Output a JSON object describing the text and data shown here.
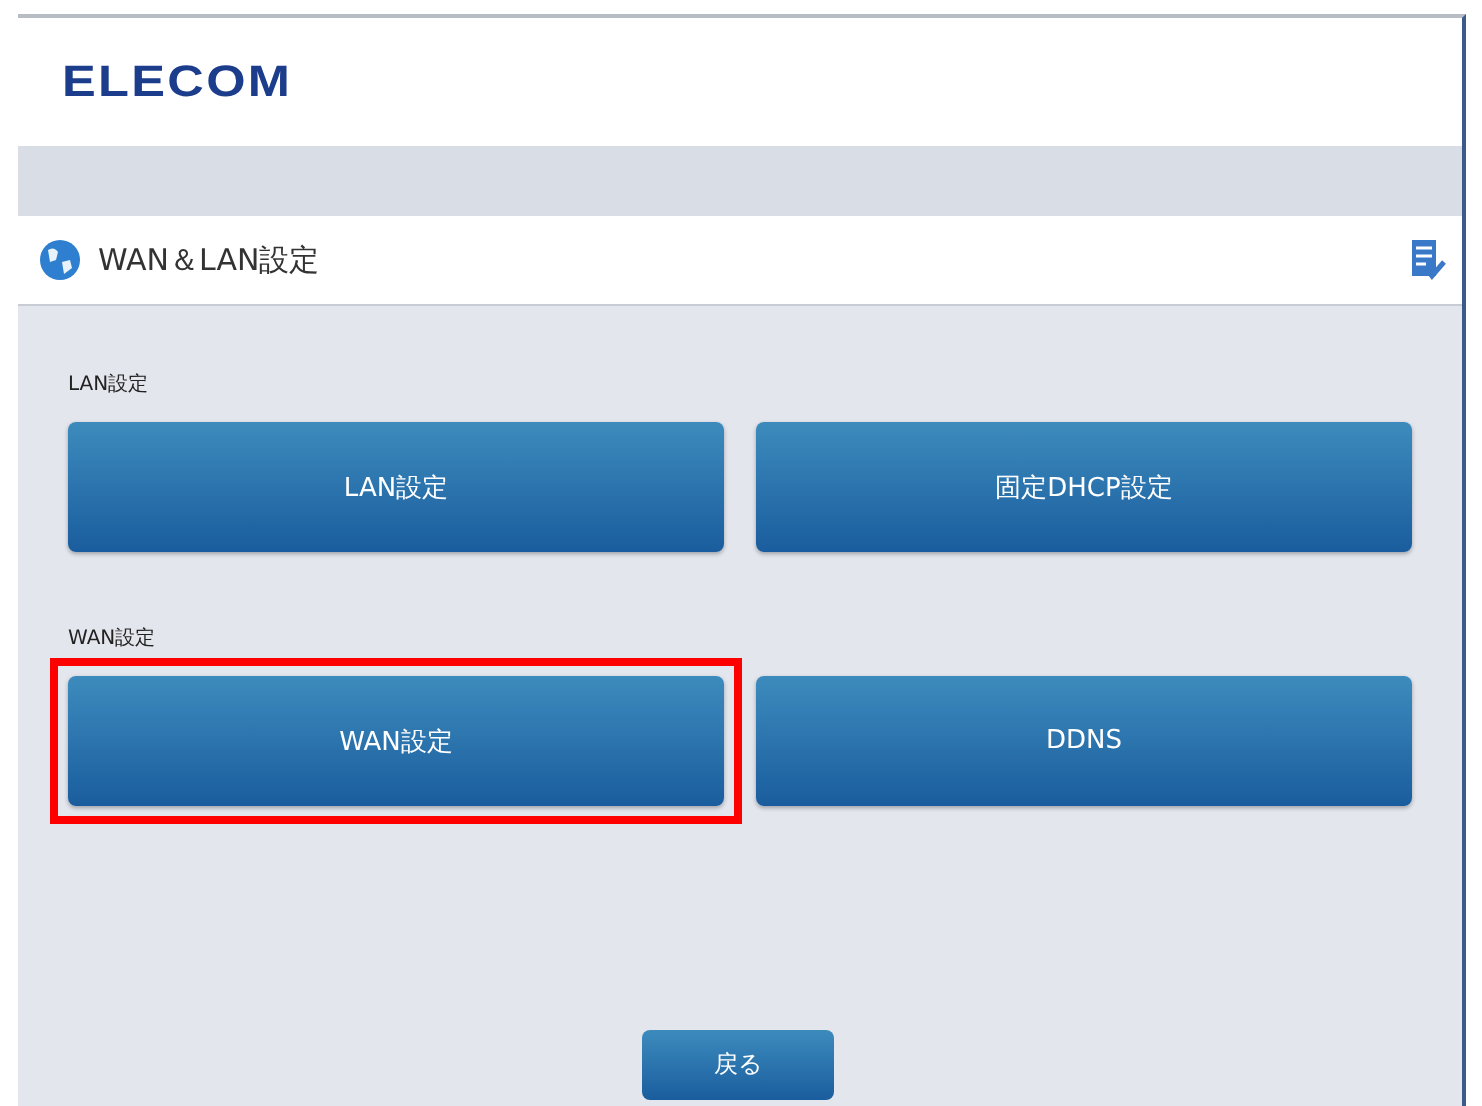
{
  "header": {
    "logo": "ELECOM"
  },
  "title_bar": {
    "title": "WAN＆LAN設定"
  },
  "sections": [
    {
      "label": "LAN設定",
      "buttons": [
        {
          "label": "LAN設定",
          "highlighted": false
        },
        {
          "label": "固定DHCP設定",
          "highlighted": false
        }
      ]
    },
    {
      "label": "WAN設定",
      "buttons": [
        {
          "label": "WAN設定",
          "highlighted": true
        },
        {
          "label": "DDNS",
          "highlighted": false
        }
      ]
    }
  ],
  "back_button": {
    "label": "戻る"
  }
}
